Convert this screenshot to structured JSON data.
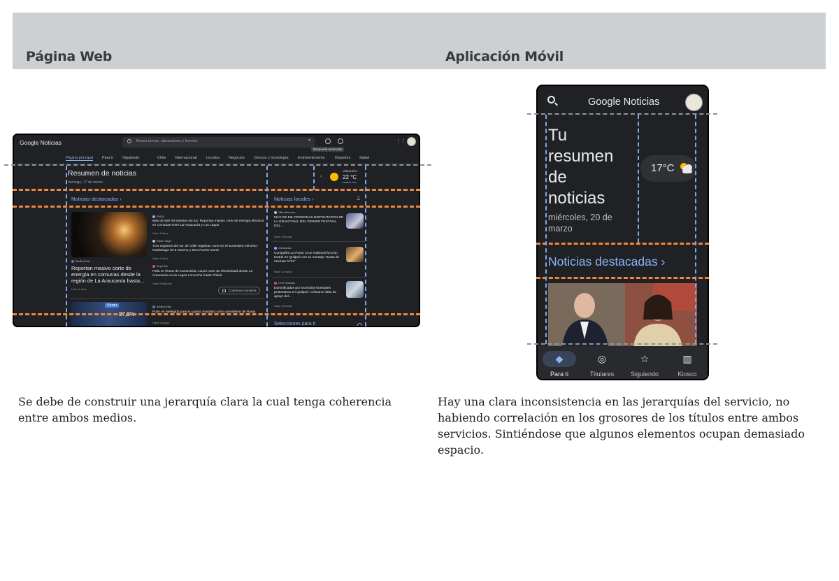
{
  "headers": {
    "web": "Página Web",
    "mobile": "Aplicación Móvil"
  },
  "captions": {
    "web": "Se debe de construir una jerarquía clara la cual tenga coherencia entre ambos medios.",
    "mobile": "Hay una clara inconsistencia en las jerarquías del servicio, no habiendo correlación en los grosores de los títulos entre ambos servicios. Sintiéndose que algunos elementos ocupan demasiado espacio."
  },
  "web": {
    "logo": "Google Noticias",
    "search_placeholder": "Busca temas, ubicaciones y fuentes",
    "tooltip": "Búsqueda avanzada",
    "nav": [
      "Página principal",
      "Para ti",
      "Siguiendo",
      "Chile",
      "Internacional",
      "Locales",
      "Negocios",
      "Ciencia y tecnología",
      "Entretenimiento",
      "Deportes",
      "Salud"
    ],
    "summary_title": "Resumen de noticias",
    "summary_date": "domingo, 17 de marzo",
    "weather": {
      "location": "Valparaíso",
      "temp": "22 °C",
      "source": "weather.com"
    },
    "featured": "Noticias destacadas",
    "local": "Noticias locales",
    "picks": "Selecciones para ti",
    "articles": [
      {
        "source": "EMOL",
        "title": "Más de 500 mil clientes sin luz: Reportan masivo corte de energía eléctrica en comunas entre La Araucanía y Los Lagos",
        "time": "Hace 1 hora"
      },
      {
        "source": "Radio Sago",
        "title": "Tres regiones del sur de Chile registran corte en el suministro eléctrico - RadioSago 94.5 Osorno y 96.5 Puerto Montt",
        "time": "Hace 1 hora"
      },
      {
        "source": "SoyChile",
        "title": "Falla en líneas de transmisión causó corte de electricidad desde La Araucanía a Los Lagos Loncoche hasta Chiloé",
        "time": "Hace 8 minutos"
      },
      {
        "source": "BioBioChile",
        "title": "Putin es reelegido para su quinto mandato como presidente de Rusia",
        "time": "Hace 3 horas"
      }
    ],
    "main_story": {
      "source": "BioBioChile",
      "title": "Reportan masivo corte de energía en comunas desde la región de La Araucanía hasta...",
      "time": "Hace 1 hora"
    },
    "coverage_button": "Cobertura completa",
    "putin_badge": "Путин",
    "putin_pct": "87,2%",
    "local_items": [
      {
        "source": "Villa Alemana",
        "title": "MÁS DE MIL PERSONAS DISFRUTARON DE LA GRAN FINAL DEL PRIMER FESTIVAL DEL...",
        "time": "Hace 18 horas"
      },
      {
        "source": "G5noticias",
        "title": "Compañía La Punto Cruz realizará función teatral en Quilpué con su montaje \"Junta de Vecinas N°91\"",
        "time": "Hace 11 horas"
      },
      {
        "source": "CHV Noticias",
        "title": "Damnificados por incendios forestales protestaron en Quilpué: Criticaron falta de apoyo del...",
        "time": "Hace 20 horas"
      }
    ]
  },
  "mobile": {
    "logo": "Google Noticias",
    "title": "Tu resumen de noticias",
    "date": "miércoles, 20 de marzo",
    "temp": "17°C",
    "featured": "Noticias destacadas ›",
    "tabs": [
      "Para ti",
      "Titulares",
      "Siguiendo",
      "Kiosco"
    ]
  },
  "colors": {
    "guide_blue": "#7fa7e6",
    "guide_orange": "#f0863c",
    "guide_gray": "#8f949b",
    "accent": "#8ab4f8"
  }
}
